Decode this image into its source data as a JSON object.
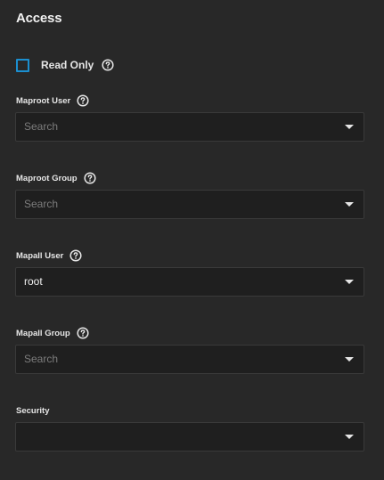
{
  "section": {
    "title": "Access"
  },
  "read_only": {
    "label": "Read Only",
    "checked": false
  },
  "fields": [
    {
      "label": "Maproot User",
      "value": "",
      "placeholder": "Search",
      "help": true
    },
    {
      "label": "Maproot Group",
      "value": "",
      "placeholder": "Search",
      "help": true
    },
    {
      "label": "Mapall User",
      "value": "root",
      "placeholder": "Search",
      "help": true
    },
    {
      "label": "Mapall Group",
      "value": "",
      "placeholder": "Search",
      "help": true
    },
    {
      "label": "Security",
      "value": "",
      "placeholder": "",
      "help": false
    }
  ],
  "icons": {
    "help": "help-circle-icon",
    "dropdown": "dropdown-caret-icon"
  },
  "colors": {
    "accent": "#1b8fd0",
    "background": "#282828",
    "field_background": "#1f1f1f"
  }
}
